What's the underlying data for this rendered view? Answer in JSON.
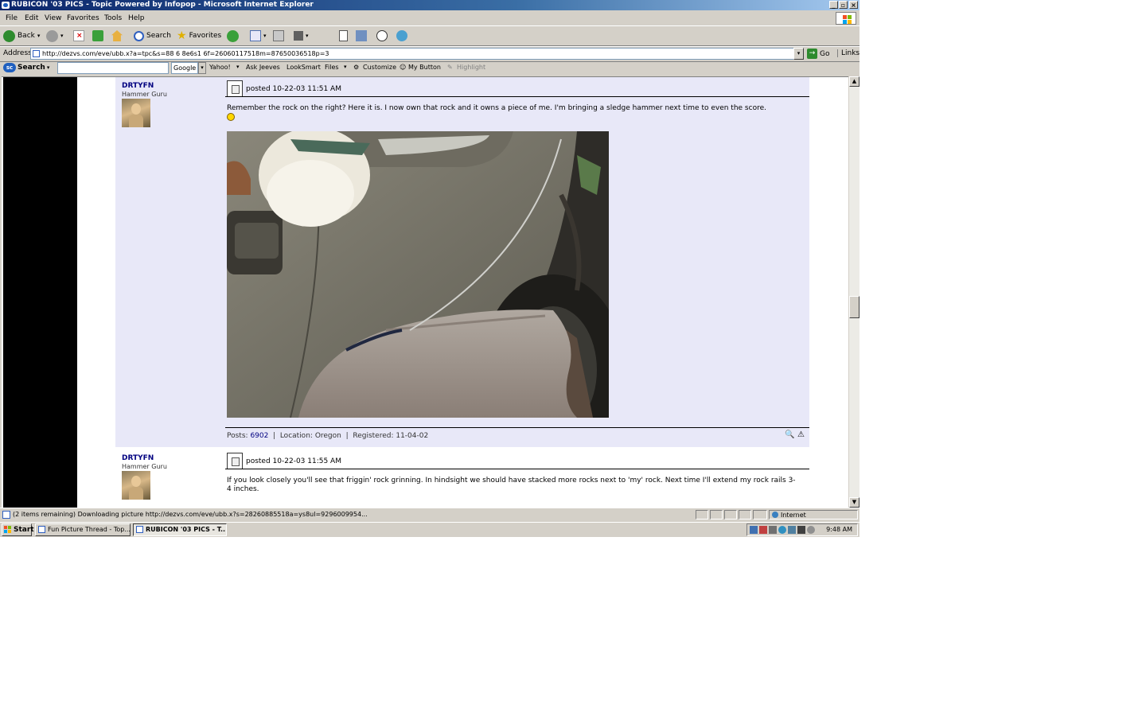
{
  "window": {
    "title": "RUBICON '03 PICS - Topic Powered by Infopop - Microsoft Internet Explorer"
  },
  "menu": [
    "File",
    "Edit",
    "View",
    "Favorites",
    "Tools",
    "Help"
  ],
  "toolbar": {
    "back": "Back",
    "search": "Search",
    "favorites": "Favorites"
  },
  "address": {
    "label": "Address",
    "url": "http://dezvs.com/eve/ubb.x?a=tpc&s=88 6 8e6s1 6f=26060117518m=87650036518p=3",
    "go": "Go",
    "links": "Links"
  },
  "searchbar": {
    "brand": "Search",
    "input": "",
    "google": "Google",
    "yahoo": "Yahoo!",
    "ask": "Ask Jeeves",
    "looksmart": "LookSmart",
    "files": "Files",
    "customize": "Customize",
    "mybutton": "My Button",
    "highlight": "Highlight"
  },
  "posts": [
    {
      "username": "DRTYFN",
      "rank": "Hammer Guru",
      "posted": "posted 10-22-03 11:51 AM",
      "body": "Remember the rock on the right? Here it is. I now own that rock and it owns a piece of me. I'm bringing a sledge hammer next time to even the score.",
      "footer": {
        "posts_label": "Posts:",
        "posts": "6902",
        "location_label": "Location:",
        "location": "Oregon",
        "registered_label": "Registered:",
        "registered": "11-04-02"
      }
    },
    {
      "username": "DRTYFN",
      "rank": "Hammer Guru",
      "posted": "posted 10-22-03 11:55 AM",
      "body": "If you look closely you'll see that friggin' rock grinning. In hindsight we should have stacked more rocks next to 'my' rock. Next time I'll extend my rock rails 3-4 inches."
    }
  ],
  "status": {
    "text": "(2 items remaining) Downloading picture http://dezvs.com/eve/ubb.x?s=28260885518a=ys8ul=9296009954...",
    "zone": "Internet"
  },
  "taskbar": {
    "start": "Start",
    "tasks": [
      "Fun Picture Thread - Top...",
      "RUBICON '03 PICS - T..."
    ],
    "clock": "9:48 AM"
  }
}
